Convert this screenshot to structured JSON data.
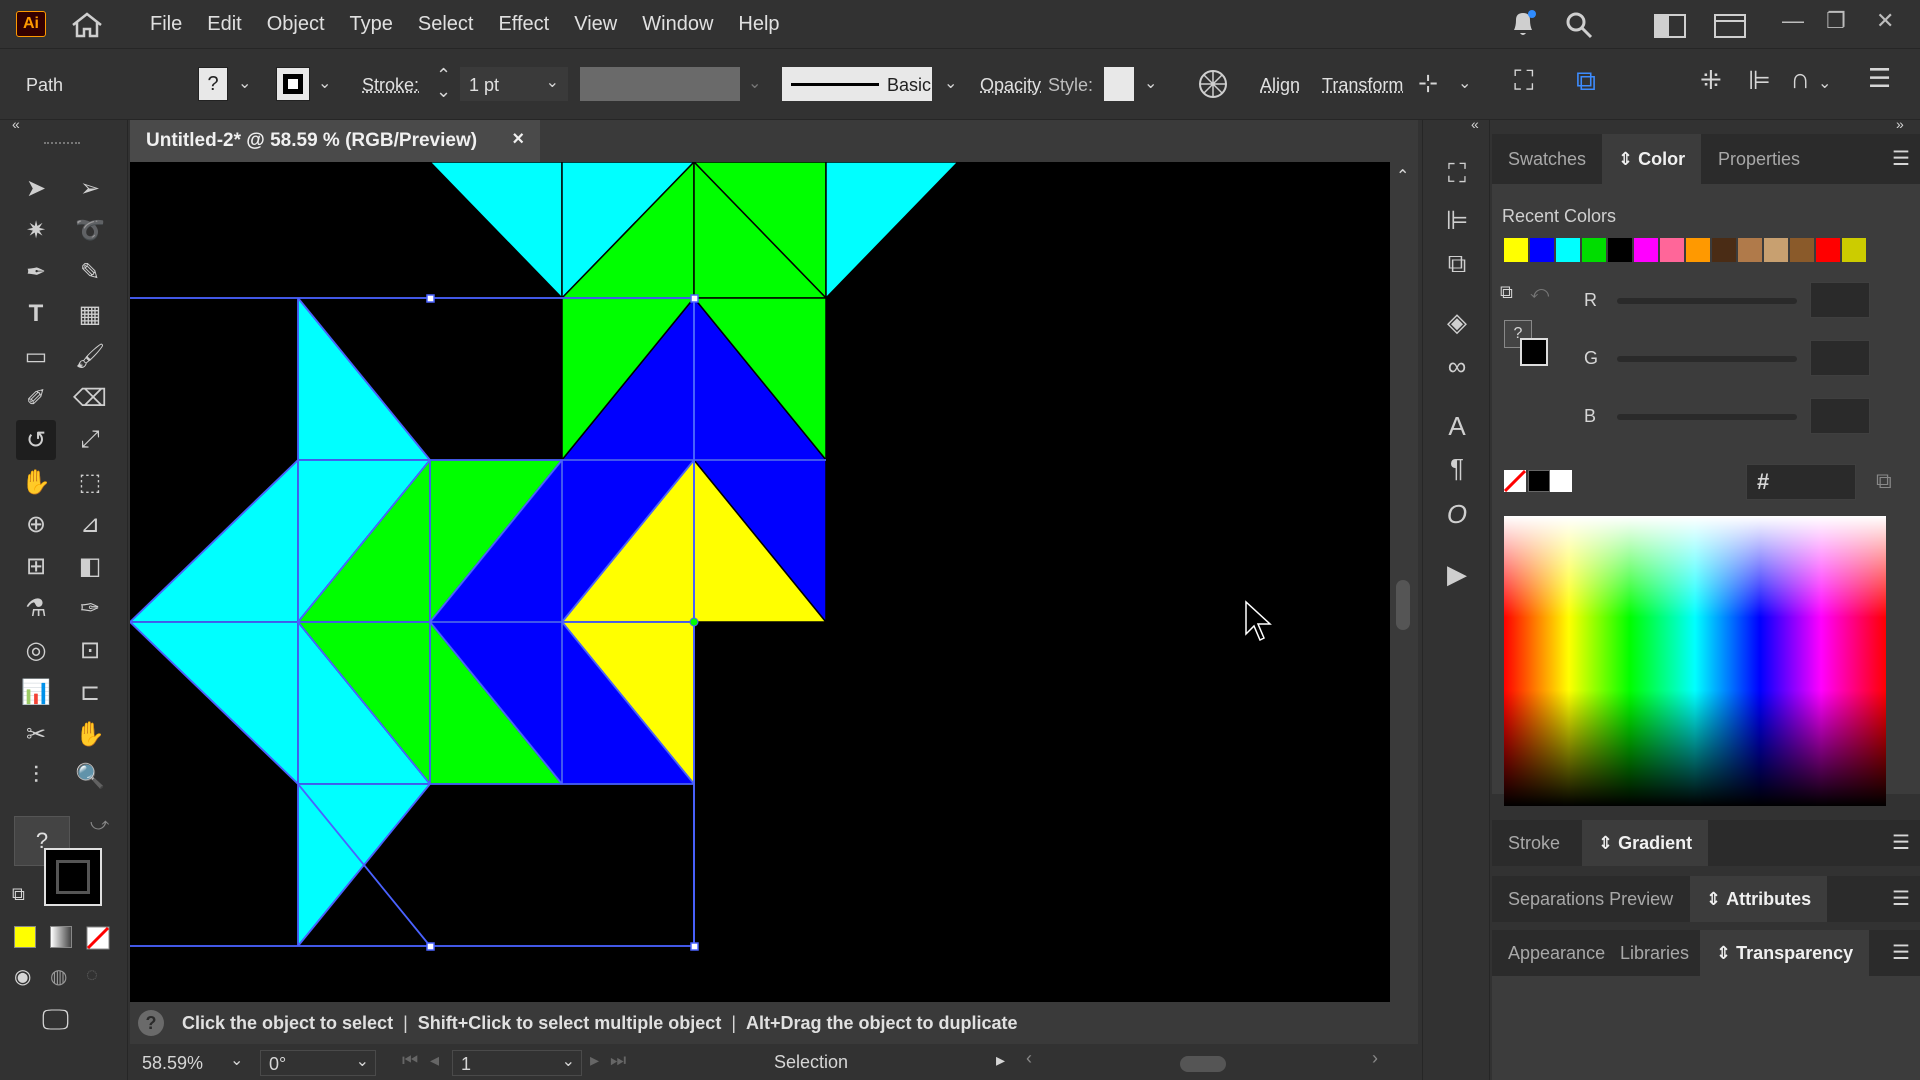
{
  "app": {
    "logo": "Ai"
  },
  "menu": [
    "File",
    "Edit",
    "Object",
    "Type",
    "Select",
    "Effect",
    "View",
    "Window",
    "Help"
  ],
  "controlbar": {
    "object_type": "Path",
    "fill_label": "?",
    "stroke_label": "Stroke:",
    "stroke_weight": "1 pt",
    "brush_label": "Basic",
    "opacity_label": "Opacity",
    "style_label": "Style:",
    "align_label": "Align",
    "transform_label": "Transform"
  },
  "document": {
    "tab_title": "Untitled-2* @ 58.59 % (RGB/Preview)",
    "close": "×"
  },
  "status": {
    "hint_1": "Click the object to select",
    "sep": "|",
    "hint_2": "Shift+Click to select multiple object",
    "hint_3": "Alt+Drag the object to duplicate",
    "zoom": "58.59%",
    "rotation": "0°",
    "artboard": "1",
    "tool": "Selection"
  },
  "panels": {
    "top_tabs": [
      "Swatches",
      "Color",
      "Properties"
    ],
    "active_top_tab": "Color",
    "recent_colors_label": "Recent Colors",
    "recent_colors": [
      "#ffff00",
      "#0000ff",
      "#00ffff",
      "#00dd00",
      "#000000",
      "#ff00ff",
      "#ff6699",
      "#ff9900",
      "#4a2c15",
      "#b07a4a",
      "#c8a070",
      "#8a5a2a",
      "#ff0000",
      "#cccc00"
    ],
    "channels": [
      "R",
      "G",
      "B"
    ],
    "hex_label": "#",
    "fill_question": "?",
    "stroke_tabs": [
      "Stroke",
      "Gradient"
    ],
    "sep_tabs": [
      "Separations Preview",
      "Attributes"
    ],
    "app_tabs": [
      "Appearance",
      "Libraries",
      "Transparency"
    ]
  },
  "tools_panel": {
    "fill_question": "?"
  },
  "colors": {
    "cyan": "#00ffff",
    "green": "#00ff00",
    "blue": "#0000ff",
    "yellow": "#ffff00",
    "selection": "#4a62ff"
  }
}
